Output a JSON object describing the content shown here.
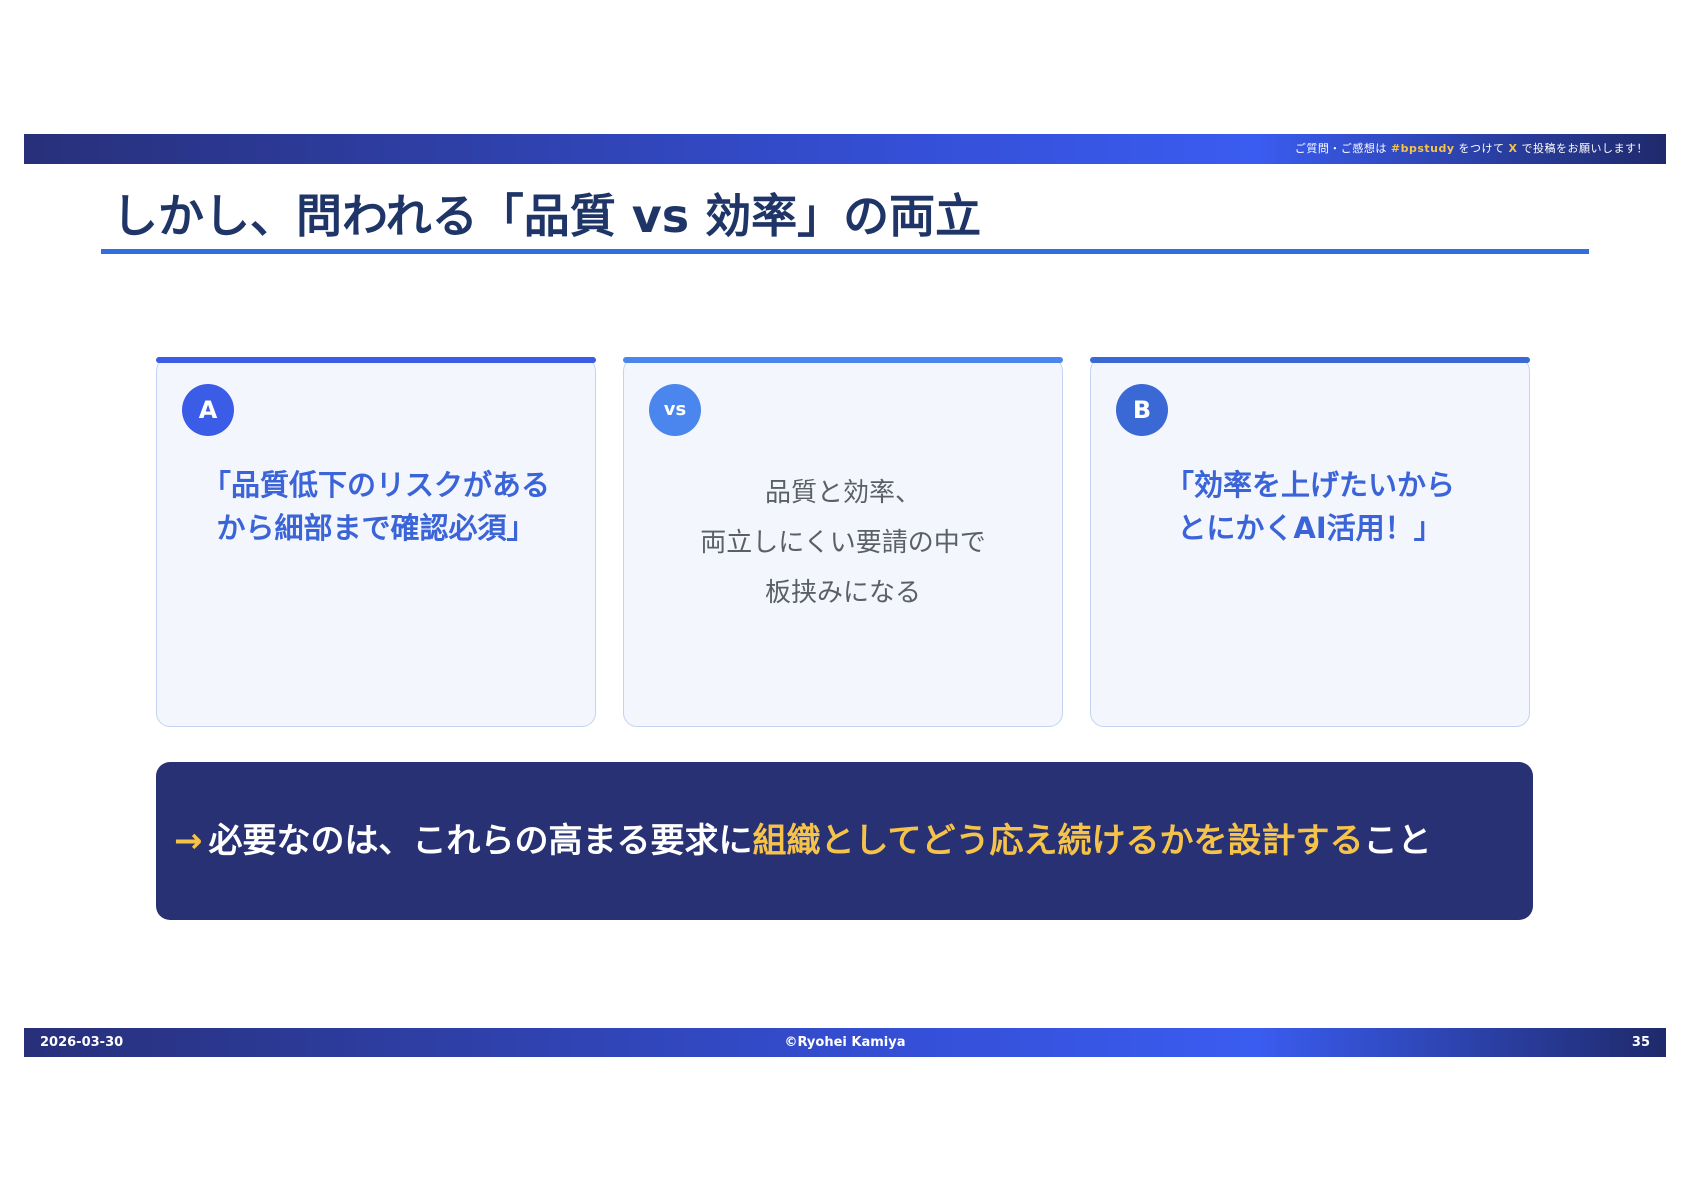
{
  "header": {
    "notice_pre": "ご質問・ご感想は",
    "hashtag": "#bpstudy",
    "notice_mid": "をつけて",
    "x": "X",
    "notice_post": "で投稿をお願いします！"
  },
  "title": "しかし、問われる「品質 vs 効率」の両立",
  "cards": [
    {
      "badge": "A",
      "lines": [
        "「品質低下のリスクがある",
        "から細部まで確認必須」"
      ],
      "color": "#3a5ce6"
    },
    {
      "badge": "vs",
      "lines": [
        "品質と効率、",
        "両立しにくい要請の中で",
        "板挟みになる"
      ],
      "color": "#4a86ee"
    },
    {
      "badge": "B",
      "lines": [
        "「効率を上げたいから",
        "とにかくAI活用！」"
      ],
      "color": "#3a68d4"
    }
  ],
  "banner": {
    "arrow": "→",
    "pre": "必要なのは、これらの高まる要求に",
    "highlight": "組織としてどう応え続けるかを設計する",
    "post": "こと"
  },
  "footer": {
    "date": "2026-03-30",
    "copyright": "©Ryohei Kamiya",
    "page": "35"
  },
  "colors": {
    "title": "#1f3568",
    "accent_yellow": "#f5c34a",
    "banner_bg": "#283174",
    "rule": "#2f6fe0"
  }
}
